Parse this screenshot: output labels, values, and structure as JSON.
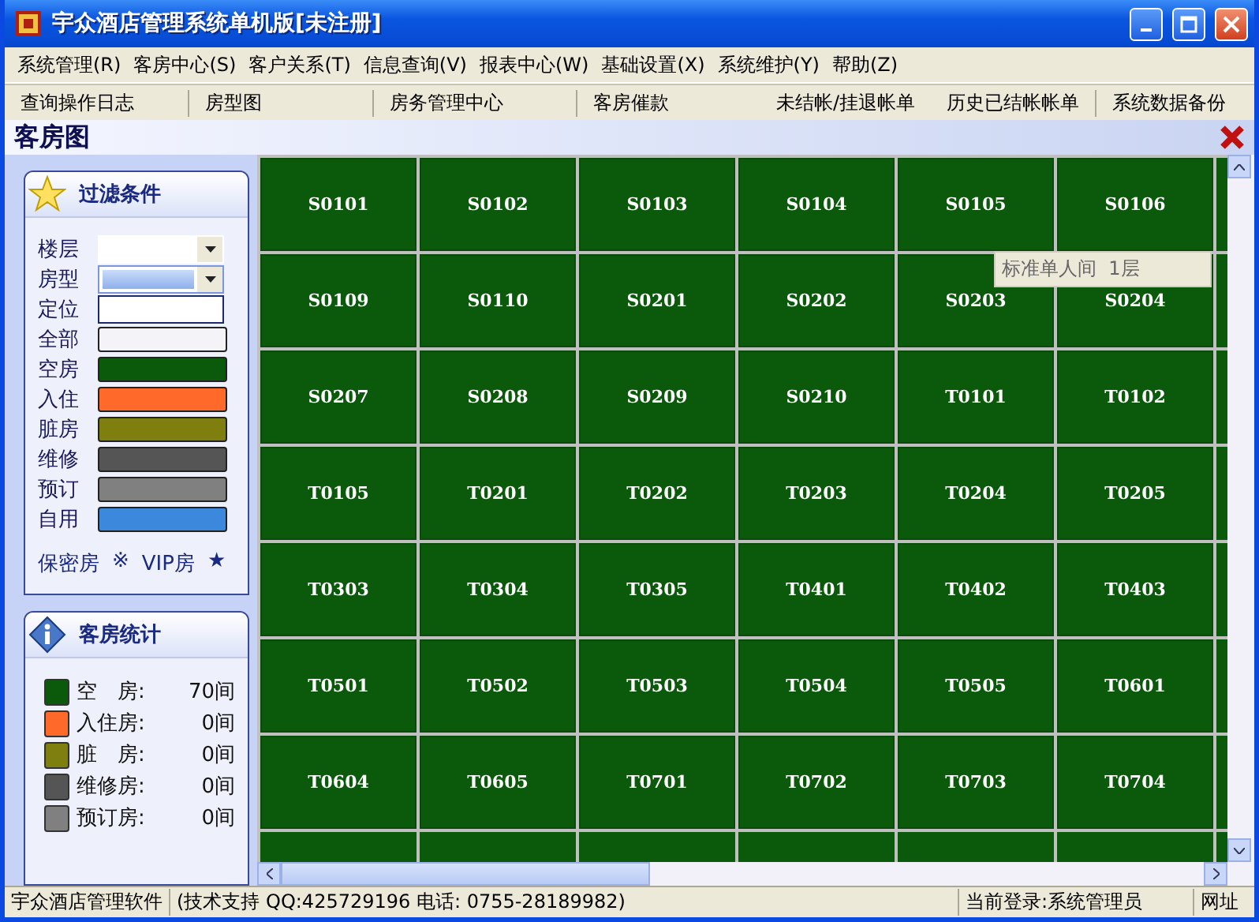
{
  "window": {
    "title": "宇众酒店管理系统单机版[未注册]"
  },
  "menu": [
    "系统管理(R)",
    "客房中心(S)",
    "客户关系(T)",
    "信息查询(V)",
    "报表中心(W)",
    "基础设置(X)",
    "系统维护(Y)",
    "帮助(Z)"
  ],
  "toolbar": [
    "查询操作日志",
    "房型图",
    "房务管理中心",
    "客房催款",
    "未结帐/挂退帐单",
    "历史已结帐帐单",
    "系统数据备份"
  ],
  "page": {
    "title": "客房图"
  },
  "filter": {
    "title": "过滤条件",
    "fields": [
      {
        "kind": "dropdown",
        "label": "楼层",
        "selected": false
      },
      {
        "kind": "dropdown",
        "label": "房型",
        "selected": true
      },
      {
        "kind": "input",
        "label": "定位"
      }
    ],
    "statuses": [
      {
        "label": "全部",
        "color": "#f4f4f8"
      },
      {
        "label": "空房",
        "color": "#0b5a0b"
      },
      {
        "label": "入住",
        "color": "#ff6a2a"
      },
      {
        "label": "脏房",
        "color": "#7f7f10"
      },
      {
        "label": "维修",
        "color": "#555555"
      },
      {
        "label": "预订",
        "color": "#808080"
      },
      {
        "label": "自用",
        "color": "#3c88dd"
      }
    ],
    "legend": [
      "保密房",
      "※",
      "VIP房",
      "★"
    ]
  },
  "stats": {
    "title": "客房统计",
    "rows": [
      {
        "label": "空　房:",
        "count": "70间",
        "color": "#0b5a0b"
      },
      {
        "label": "入住房:",
        "count": "0间",
        "color": "#ff6a2a"
      },
      {
        "label": "脏　房:",
        "count": "0间",
        "color": "#7f7f10"
      },
      {
        "label": "维修房:",
        "count": "0间",
        "color": "#555555"
      },
      {
        "label": "预订房:",
        "count": "0间",
        "color": "#808080"
      }
    ]
  },
  "rooms": [
    {
      "name": "S0101",
      "color": "#0b5a0b"
    },
    {
      "name": "S0102",
      "color": "#0b5a0b"
    },
    {
      "name": "S0103",
      "color": "#0b5a0b"
    },
    {
      "name": "S0104",
      "color": "#0b5a0b"
    },
    {
      "name": "S0105",
      "color": "#0b5a0b"
    },
    {
      "name": "S0106",
      "color": "#0b5a0b"
    },
    {
      "name": "S0109",
      "color": "#0b5a0b"
    },
    {
      "name": "S0110",
      "color": "#0b5a0b"
    },
    {
      "name": "S0201",
      "color": "#0b5a0b"
    },
    {
      "name": "S0202",
      "color": "#0b5a0b"
    },
    {
      "name": "S0203",
      "color": "#0b5a0b"
    },
    {
      "name": "S0204",
      "color": "#0b5a0b"
    },
    {
      "name": "S0207",
      "color": "#0b5a0b"
    },
    {
      "name": "S0208",
      "color": "#0b5a0b"
    },
    {
      "name": "S0209",
      "color": "#0b5a0b"
    },
    {
      "name": "S0210",
      "color": "#0b5a0b"
    },
    {
      "name": "T0101",
      "color": "#0b5a0b"
    },
    {
      "name": "T0102",
      "color": "#0b5a0b"
    },
    {
      "name": "T0105",
      "color": "#0b5a0b"
    },
    {
      "name": "T0201",
      "color": "#0b5a0b"
    },
    {
      "name": "T0202",
      "color": "#0b5a0b"
    },
    {
      "name": "T0203",
      "color": "#0b5a0b"
    },
    {
      "name": "T0204",
      "color": "#0b5a0b"
    },
    {
      "name": "T0205",
      "color": "#0b5a0b"
    },
    {
      "name": "T0303",
      "color": "#0b5a0b"
    },
    {
      "name": "T0304",
      "color": "#0b5a0b"
    },
    {
      "name": "T0305",
      "color": "#0b5a0b"
    },
    {
      "name": "T0401",
      "color": "#0b5a0b"
    },
    {
      "name": "T0402",
      "color": "#0b5a0b"
    },
    {
      "name": "T0403",
      "color": "#0b5a0b"
    },
    {
      "name": "T0501",
      "color": "#0b5a0b"
    },
    {
      "name": "T0502",
      "color": "#0b5a0b"
    },
    {
      "name": "T0503",
      "color": "#0b5a0b"
    },
    {
      "name": "T0504",
      "color": "#0b5a0b"
    },
    {
      "name": "T0505",
      "color": "#0b5a0b"
    },
    {
      "name": "T0601",
      "color": "#0b5a0b"
    },
    {
      "name": "T0604",
      "color": "#0b5a0b"
    },
    {
      "name": "T0605",
      "color": "#0b5a0b"
    },
    {
      "name": "T0701",
      "color": "#0b5a0b"
    },
    {
      "name": "T0702",
      "color": "#0b5a0b"
    },
    {
      "name": "T0703",
      "color": "#0b5a0b"
    },
    {
      "name": "T0704",
      "color": "#0b5a0b"
    }
  ],
  "tooltip": "标准单人间  1层",
  "status_bar": [
    "宇众酒店管理软件",
    "(技术支持 QQ:425729196 电话: 0755-28189982)",
    "当前登录:系统管理员",
    "网址"
  ]
}
